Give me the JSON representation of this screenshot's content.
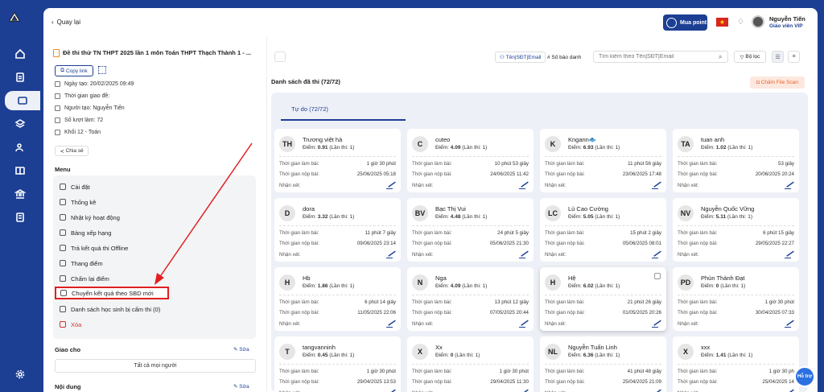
{
  "rail": {
    "items": [
      "logo-icon",
      "home-icon",
      "document-icon",
      "folder-icon",
      "layers-icon",
      "users-icon",
      "book-icon",
      "bank-icon",
      "calendar-icon",
      "settings-icon"
    ]
  },
  "header": {
    "back_label": "Quay lại",
    "buy_button": "Mua point",
    "user_name": "Nguyễn Tiến",
    "user_role": "Giáo viên VIP",
    "flag_star": "★"
  },
  "sidebar": {
    "exam_title": "Đề thi thử TN THPT 2025 lần 1 môn Toán THPT Thạch Thành 1 - ...",
    "copy_link": "Copy link",
    "created_date": "Ngày tạo: 20/02/2025 09:49",
    "assign_time": "Thời gian giao đề:",
    "creator": "Người tạo: Nguyễn Tiến",
    "attempts": "Số lượt làm: 72",
    "grade": "Khối 12 - Toán",
    "share": "Chia sẻ",
    "menu_heading": "Menu",
    "menu_items": [
      {
        "label": "Cài đặt",
        "icon": "gear-icon"
      },
      {
        "label": "Thống kê",
        "icon": "chart-icon"
      },
      {
        "label": "Nhật ký hoạt động",
        "icon": "activity-icon"
      },
      {
        "label": "Bảng xếp hạng",
        "icon": "ranking-icon"
      },
      {
        "label": "Trả kết quả thi Offline",
        "icon": "export-icon"
      },
      {
        "label": "Thang điểm",
        "icon": "scale-icon"
      },
      {
        "label": "Chấm lại điểm",
        "icon": "refresh-icon"
      },
      {
        "label": "Chuyển kết quả theo SBD mới",
        "icon": "transfer-icon"
      },
      {
        "label": "Danh sách học sinh bị cấm thi (0)",
        "icon": "user-block-icon"
      },
      {
        "label": "Xóa",
        "icon": "trash-icon"
      }
    ],
    "assign_heading": "Giao cho",
    "edit_label": "Sửa",
    "assign_value": "Tất cả mọi người",
    "content_heading": "Nội dung"
  },
  "toolbar": {
    "tab_name": "Tên|SĐT|Email",
    "tab_sbd": "Số báo danh",
    "search_placeholder": "Tìm kiếm theo Tên|SĐT|Email",
    "filter": "Bộ lọc",
    "scan": "Chấm File Scan"
  },
  "list": {
    "heading": "Danh sách đã thi (72/72)",
    "tab": "Tự do (72/72)",
    "label_duration": "Thời gian làm bài:",
    "label_submit": "Thời gian nộp bài:",
    "label_comment": "Nhận xét:",
    "students": [
      {
        "initials": "TH",
        "name": "Trương việt hà",
        "score_label": "Điểm:",
        "score": "0.91",
        "attempt": "(Lần thi: 1)",
        "duration": "1 giờ 30 phút",
        "submitted": "25/06/2025 05:18"
      },
      {
        "initials": "C",
        "name": "cuteo",
        "score_label": "Điểm:",
        "score": "4.09",
        "attempt": "(Lần thi: 1)",
        "duration": "10 phút 53 giây",
        "submitted": "24/06/2025 11:42"
      },
      {
        "initials": "K",
        "name": "Kngann🐟",
        "score_label": "Điểm:",
        "score": "6.93",
        "attempt": "(Lần thi: 1)",
        "duration": "11 phút 56 giây",
        "submitted": "23/06/2025 17:48"
      },
      {
        "initials": "TA",
        "name": "tuan anh",
        "score_label": "Điểm:",
        "score": "1.02",
        "attempt": "(Lần thi: 1)",
        "duration": "53 giây",
        "submitted": "20/06/2025 20:24"
      },
      {
        "initials": "D",
        "name": "dora",
        "score_label": "Điểm:",
        "score": "3.32",
        "attempt": "(Lần thi: 1)",
        "duration": "11 phút 7 giây",
        "submitted": "09/06/2025 23:14"
      },
      {
        "initials": "BV",
        "name": "Bạc Thị Vui",
        "score_label": "Điểm:",
        "score": "4.48",
        "attempt": "(Lần thi: 1)",
        "duration": "24 phút 5 giây",
        "submitted": "05/06/2025 21:30"
      },
      {
        "initials": "LC",
        "name": "Lù Cao Cường",
        "score_label": "Điểm:",
        "score": "5.05",
        "attempt": "(Lần thi: 1)",
        "duration": "15 phút 2 giây",
        "submitted": "05/06/2025 08:01"
      },
      {
        "initials": "NV",
        "name": "Nguyễn Quốc Vững",
        "score_label": "Điểm:",
        "score": "5.11",
        "attempt": "(Lần thi: 1)",
        "duration": "6 phút 15 giây",
        "submitted": "29/05/2025 22:27"
      },
      {
        "initials": "H",
        "name": "Hb",
        "score_label": "Điểm:",
        "score": "1.86",
        "attempt": "(Lần thi: 1)",
        "duration": "6 phút 14 giây",
        "submitted": "11/05/2025 22:06"
      },
      {
        "initials": "N",
        "name": "Nga",
        "score_label": "Điểm:",
        "score": "4.09",
        "attempt": "(Lần thi: 1)",
        "duration": "13 phút 12 giây",
        "submitted": "07/05/2025 20:44"
      },
      {
        "initials": "H",
        "name": "Hệ",
        "score_label": "Điểm:",
        "score": "6.02",
        "attempt": "(Lần thi: 1)",
        "duration": "21 phút 26 giây",
        "submitted": "01/05/2025 20:26"
      },
      {
        "initials": "PD",
        "name": "Phùn Thành Đạt",
        "score_label": "Điểm:",
        "score": "0",
        "attempt": "(Lần thi: 1)",
        "duration": "1 giờ 30 phút",
        "submitted": "30/04/2025 07:33"
      },
      {
        "initials": "T",
        "name": "tangvanninh",
        "score_label": "Điểm:",
        "score": "0.45",
        "attempt": "(Lần thi: 1)",
        "duration": "1 giờ 30 phút",
        "submitted": "29/04/2025 13:53"
      },
      {
        "initials": "X",
        "name": "Xx",
        "score_label": "Điểm:",
        "score": "0",
        "attempt": "(Lần thi: 1)",
        "duration": "1 giờ 30 phút",
        "submitted": "29/04/2025 11:30"
      },
      {
        "initials": "NL",
        "name": "Nguyễn Tuấn Linh",
        "score_label": "Điểm:",
        "score": "6.36",
        "attempt": "(Lần thi: 1)",
        "duration": "41 phút 48 giây",
        "submitted": "25/04/2025 21:09"
      },
      {
        "initials": "X",
        "name": "xxx",
        "score_label": "Điểm:",
        "score": "1.41",
        "attempt": "(Lần thi: 1)",
        "duration": "1 giờ 30 ph",
        "submitted": "25/04/2025 14"
      }
    ]
  },
  "chat_fab": "Hỗ trợ",
  "colors": {
    "brand": "#1c3f93",
    "danger": "#e02020",
    "accent": "#e0642f"
  }
}
